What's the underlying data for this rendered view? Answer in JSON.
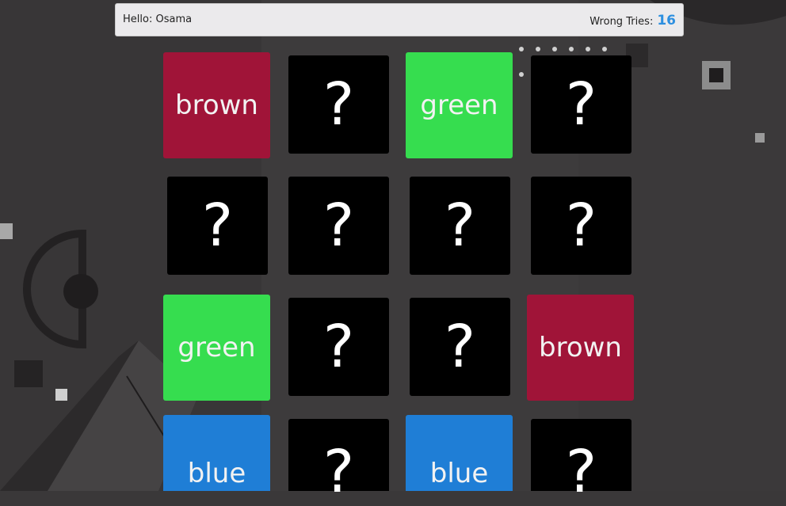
{
  "header": {
    "greeting_label": "Hello:",
    "player_name": "Osama",
    "wrong_tries_label": "Wrong Tries:",
    "wrong_tries_count": "16"
  },
  "cards": [
    {
      "state": "revealed",
      "label": "brown",
      "color": "#a01438"
    },
    {
      "state": "hidden",
      "label": "?"
    },
    {
      "state": "revealed",
      "label": "green",
      "color": "#36dd4f"
    },
    {
      "state": "hidden",
      "label": "?"
    },
    {
      "state": "hidden",
      "label": "?"
    },
    {
      "state": "hidden",
      "label": "?"
    },
    {
      "state": "hidden",
      "label": "?"
    },
    {
      "state": "hidden",
      "label": "?"
    },
    {
      "state": "revealed",
      "label": "green",
      "color": "#36dd4f"
    },
    {
      "state": "hidden",
      "label": "?"
    },
    {
      "state": "hidden",
      "label": "?"
    },
    {
      "state": "revealed",
      "label": "brown",
      "color": "#a01438"
    },
    {
      "state": "revealed",
      "label": "blue",
      "color": "#1f7ed6"
    },
    {
      "state": "hidden",
      "label": "?"
    },
    {
      "state": "revealed",
      "label": "blue",
      "color": "#1f7ed6"
    },
    {
      "state": "hidden",
      "label": "?"
    }
  ]
}
